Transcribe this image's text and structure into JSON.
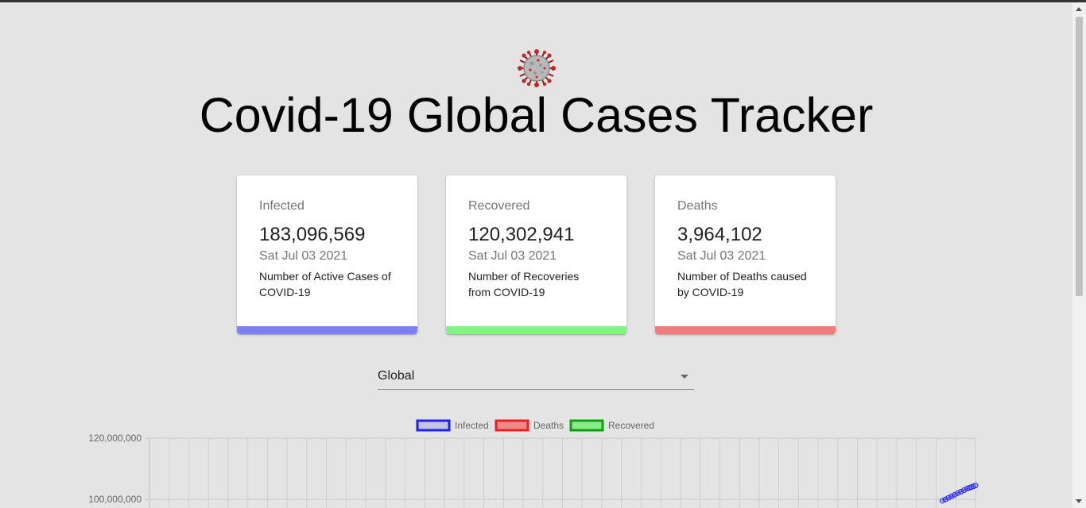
{
  "header": {
    "title": "Covid-19 Global Cases Tracker",
    "logo_icon": "virus-icon"
  },
  "cards": [
    {
      "label": "Infected",
      "value": "183,096,569",
      "date": "Sat Jul 03 2021",
      "description": "Number of Active Cases of COVID-19",
      "color": "#7f7ff5"
    },
    {
      "label": "Recovered",
      "value": "120,302,941",
      "date": "Sat Jul 03 2021",
      "description": "Number of Recoveries from COVID-19",
      "color": "#80f580"
    },
    {
      "label": "Deaths",
      "value": "3,964,102",
      "date": "Sat Jul 03 2021",
      "description": "Number of Deaths caused by COVID-19",
      "color": "#f47b7b"
    }
  ],
  "country_select": {
    "selected": "Global",
    "icon": "caret-down-icon"
  },
  "chart_data": {
    "type": "line",
    "title": "",
    "xlabel": "",
    "ylabel": "",
    "legend_position": "top-center",
    "y_ticks": [
      "120,000,000",
      "100,000,000"
    ],
    "ylim": [
      100000000,
      120000000
    ],
    "grid": true,
    "series": [
      {
        "name": "Infected",
        "border": "#2020f0",
        "fill": "rgba(160,160,220,0.45)",
        "points": [
          [
            0.96,
            99500000
          ],
          [
            0.975,
            101500000
          ],
          [
            0.99,
            103500000
          ],
          [
            1.0,
            104500000
          ]
        ]
      },
      {
        "name": "Deaths",
        "border": "#ee2020",
        "fill": "rgba(240,100,100,0.7)",
        "points": []
      },
      {
        "name": "Recovered",
        "border": "#10a010",
        "fill": "rgba(100,240,100,0.7)",
        "points": []
      }
    ]
  }
}
